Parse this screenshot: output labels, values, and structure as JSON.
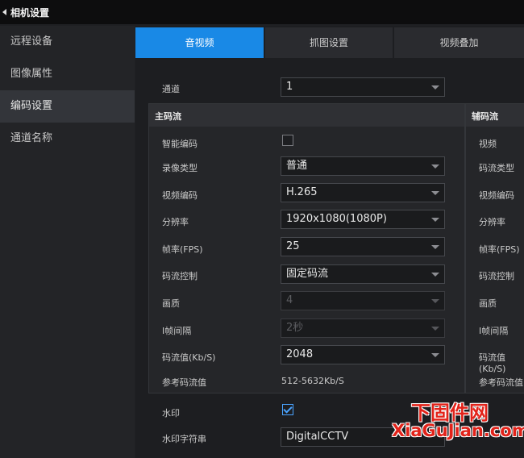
{
  "window": {
    "title": "相机设置"
  },
  "sidebar": {
    "items": [
      {
        "label": "远程设备"
      },
      {
        "label": "图像属性"
      },
      {
        "label": "编码设置",
        "active": true
      },
      {
        "label": "通道名称"
      }
    ]
  },
  "tabs": [
    {
      "label": "音视频",
      "active": true
    },
    {
      "label": "抓图设置"
    },
    {
      "label": "视频叠加"
    }
  ],
  "channel": {
    "label": "通道",
    "value": "1"
  },
  "main_stream": {
    "title": "主码流",
    "smart_codec": {
      "label": "智能编码",
      "checked": false
    },
    "record_type": {
      "label": "录像类型",
      "value": "普通"
    },
    "video_codec": {
      "label": "视频编码",
      "value": "H.265"
    },
    "resolution": {
      "label": "分辨率",
      "value": "1920x1080(1080P)"
    },
    "frame_rate": {
      "label": "帧率(FPS)",
      "value": "25"
    },
    "bitrate_control": {
      "label": "码流控制",
      "value": "固定码流"
    },
    "quality": {
      "label": "画质",
      "value": "4"
    },
    "i_frame_interval": {
      "label": "I帧间隔",
      "value": "2秒"
    },
    "bitrate": {
      "label": "码流值(Kb/S)",
      "value": "2048"
    },
    "ref_bitrate": {
      "label": "参考码流值",
      "value": "512-5632Kb/S"
    }
  },
  "sub_stream": {
    "title": "辅码流",
    "labels": {
      "video": "视频",
      "stream_type": "码流类型",
      "video_codec": "视频编码",
      "resolution": "分辨率",
      "frame_rate": "帧率(FPS)",
      "bitrate_control": "码流控制",
      "quality": "画质",
      "i_frame_interval": "I帧间隔",
      "bitrate": "码流值(Kb/S)",
      "ref_bitrate": "参考码流值"
    }
  },
  "watermark": {
    "label": "水印",
    "checked": true
  },
  "watermark_text": {
    "label": "水印字符串",
    "value": "DigitalCCTV"
  },
  "site_logo": {
    "top": "下固件网",
    "bottom": "XiaGuJian.com"
  },
  "colors": {
    "accent": "#1989e6",
    "background": "#1f2023",
    "logo_red": "#e2231a"
  }
}
